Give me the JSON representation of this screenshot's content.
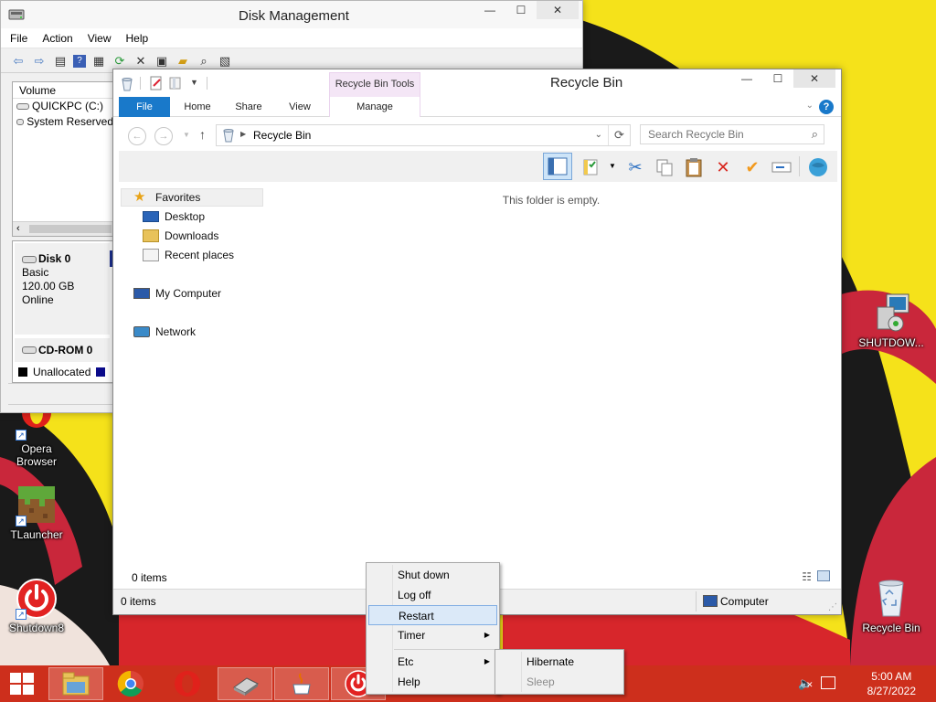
{
  "desktop": {
    "icons": [
      {
        "label": "Opera Browser",
        "lines": [
          "Opera",
          "Browser"
        ]
      },
      {
        "label": "TLauncher"
      },
      {
        "label": "Shutdown8"
      },
      {
        "label": "SHUTDOW..."
      },
      {
        "label": "Recycle Bin"
      }
    ]
  },
  "disk_management": {
    "title": "Disk Management",
    "menu": [
      "File",
      "Action",
      "View",
      "Help"
    ],
    "volume_header": "Volume",
    "volumes": [
      "QUICKPC (C:)",
      "System Reserved"
    ],
    "disks": [
      {
        "name": "Disk 0",
        "type": "Basic",
        "size": "120.00 GB",
        "status": "Online"
      },
      {
        "name": "CD-ROM 0"
      }
    ],
    "legend_unallocated": "Unallocated"
  },
  "recycle_bin": {
    "title": "Recycle Bin",
    "contextual_group": "Recycle Bin Tools",
    "tabs": [
      "File",
      "Home",
      "Share",
      "View",
      "Manage"
    ],
    "address": "Recycle Bin",
    "search_placeholder": "Search Recycle Bin",
    "nav": {
      "favorites": "Favorites",
      "desktop": "Desktop",
      "downloads": "Downloads",
      "recent": "Recent places",
      "my_computer": "My Computer",
      "network": "Network"
    },
    "empty_message": "This folder is empty.",
    "item_count": "0 items",
    "status_count": "0 items",
    "status_location": "Computer"
  },
  "context_menu": {
    "items": [
      "Shut down",
      "Log off",
      "Restart",
      "Timer",
      "Etc",
      "Help"
    ],
    "highlighted": "Restart",
    "submenu": [
      "Hibernate",
      "Sleep"
    ]
  },
  "taskbar": {
    "time": "5:00 AM",
    "date": "8/27/2022"
  },
  "colors": {
    "wallpaper_yellow": "#f5e21a",
    "taskbar_red": "#cd2f1c",
    "file_tab_blue": "#1979ca",
    "contextual_pink": "#f4e6f6"
  }
}
